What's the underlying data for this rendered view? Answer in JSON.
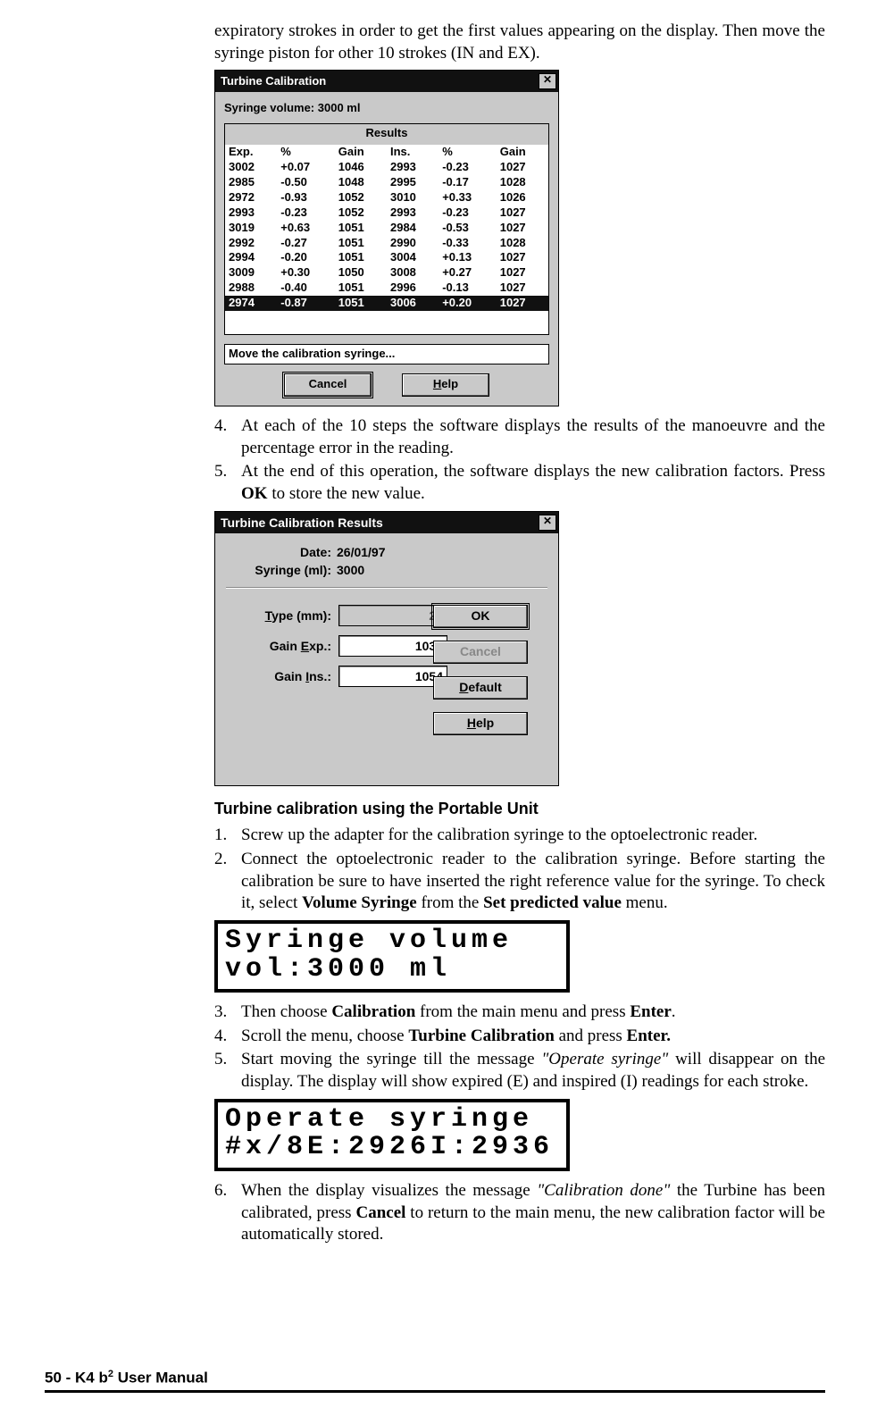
{
  "intro": "expiratory strokes in order to get the first values appearing on the display. Then move the syringe piston for other 10 strokes (IN and EX).",
  "win1": {
    "title": "Turbine Calibration",
    "close": "✕",
    "syringe_line": "Syringe volume: 3000 ml",
    "results_label": "Results",
    "headers": [
      "Exp.",
      "%",
      "Gain",
      "Ins.",
      "%",
      "Gain"
    ],
    "rows": [
      [
        "3002",
        "+0.07",
        "1046",
        "2993",
        "-0.23",
        "1027"
      ],
      [
        "2985",
        "-0.50",
        "1048",
        "2995",
        "-0.17",
        "1028"
      ],
      [
        "2972",
        "-0.93",
        "1052",
        "3010",
        "+0.33",
        "1026"
      ],
      [
        "2993",
        "-0.23",
        "1052",
        "2993",
        "-0.23",
        "1027"
      ],
      [
        "3019",
        "+0.63",
        "1051",
        "2984",
        "-0.53",
        "1027"
      ],
      [
        "2992",
        "-0.27",
        "1051",
        "2990",
        "-0.33",
        "1028"
      ],
      [
        "2994",
        "-0.20",
        "1051",
        "3004",
        "+0.13",
        "1027"
      ],
      [
        "3009",
        "+0.30",
        "1050",
        "3008",
        "+0.27",
        "1027"
      ],
      [
        "2988",
        "-0.40",
        "1051",
        "2996",
        "-0.13",
        "1027"
      ],
      [
        "2974",
        "-0.87",
        "1051",
        "3006",
        "+0.20",
        "1027"
      ]
    ],
    "selected_row": 9,
    "message": "Move the calibration syringe...",
    "cancel": "Cancel",
    "help": "Help"
  },
  "step4": "At each of the 10 steps the software displays the results of the manoeuvre and the percentage error in the reading.",
  "step5_a": "At the end of this operation, the software displays the new calibration factors. Press ",
  "step5_b": "OK",
  "step5_c": " to store the new value.",
  "win2": {
    "title": "Turbine Calibration Results",
    "close": "✕",
    "date_label": "Date:",
    "date": "26/01/97",
    "syr_label": "Syringe (ml):",
    "syr": "3000",
    "type_label": "Type (mm):",
    "type_val": "28",
    "gexp_label": "Gain Exp.:",
    "gexp_val": "1038",
    "gins_label": "Gain Ins.:",
    "gins_val": "1054",
    "ok": "OK",
    "cancel": "Cancel",
    "default": "Default",
    "help": "Help"
  },
  "sec2_title": "Turbine calibration using the Portable Unit",
  "s2_1": "Screw up the adapter for the calibration syringe to the optoelectronic reader.",
  "s2_2_a": "Connect the optoelectronic reader to the calibration syringe. Before starting the calibration be sure to have inserted the right reference value for the syringe. To check it, select ",
  "s2_2_b": "Volume Syringe",
  "s2_2_c": " from the ",
  "s2_2_d": "Set predicted value",
  "s2_2_e": " menu.",
  "lcd1_l1": "Syringe volume",
  "lcd1_l2": "vol:3000 ml",
  "s2_3_a": "Then choose ",
  "s2_3_b": "Calibration",
  "s2_3_c": " from the main menu and press ",
  "s2_3_d": "Enter",
  "s2_3_e": ".",
  "s2_4_a": "Scroll the menu, choose ",
  "s2_4_b": "Turbine Calibration",
  "s2_4_c": " and press ",
  "s2_4_d": "Enter.",
  "s2_5_a": "Start moving the syringe till the message ",
  "s2_5_b": "\"Operate syringe\"",
  "s2_5_c": " will disappear on the display. The display will show expired (E) and inspired (I) readings for each stroke.",
  "lcd2_l1": "Operate syringe",
  "lcd2_l2": "#x/8E:2926I:2936",
  "s2_6_a": "When the display visualizes the message ",
  "s2_6_b": "\"Calibration done\"",
  "s2_6_c": " the Turbine has been calibrated, press ",
  "s2_6_d": "Cancel",
  "s2_6_e": " to return to the main menu, the new calibration factor will be automatically stored.",
  "footer_a": "50 - K4 b",
  "footer_sup": "2",
  "footer_b": " User Manual"
}
